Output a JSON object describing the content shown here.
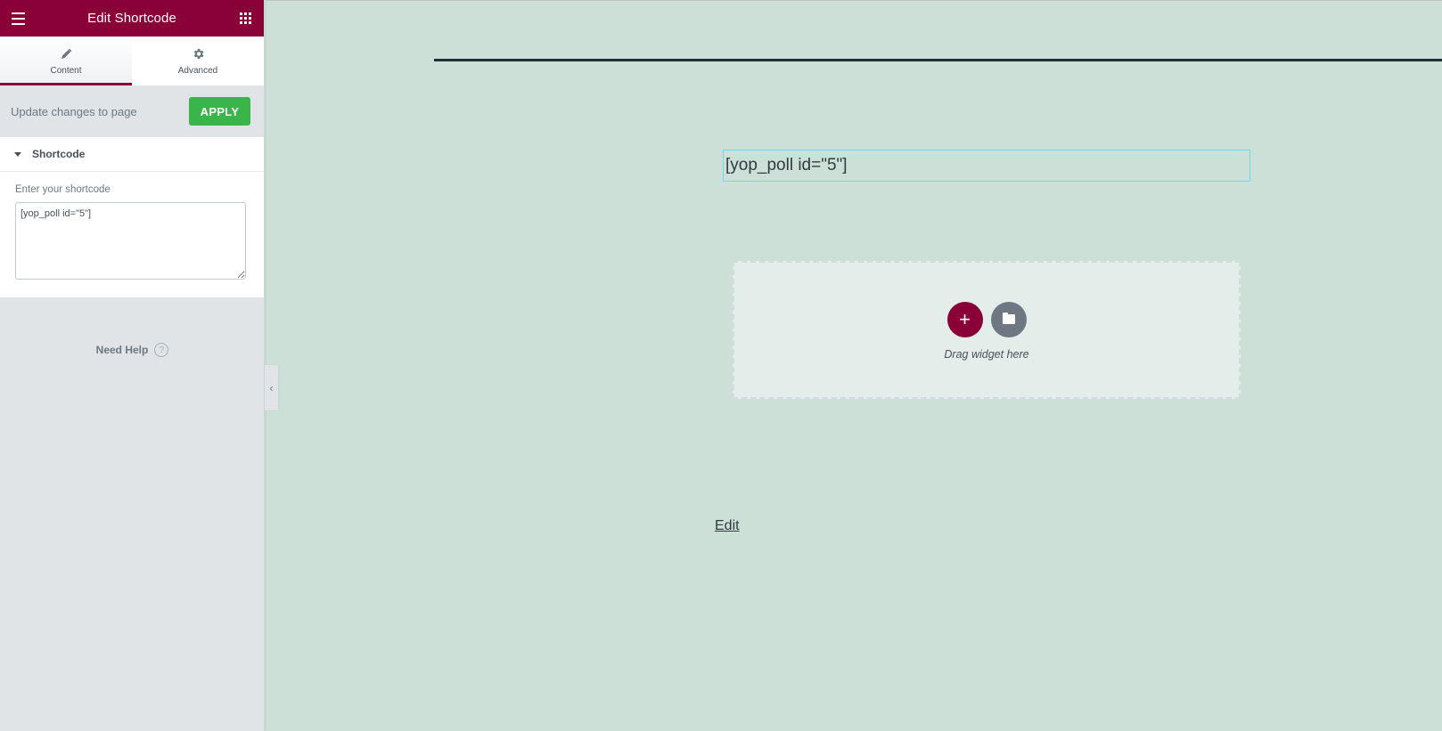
{
  "panel": {
    "header": {
      "title": "Edit Shortcode",
      "menu_icon": "hamburger-icon",
      "widgets_icon": "grid-icon"
    },
    "tabs": [
      {
        "label": "Content",
        "icon": "pencil-icon",
        "active": true
      },
      {
        "label": "Advanced",
        "icon": "gear-icon",
        "active": false
      }
    ],
    "apply": {
      "label": "Update changes to page",
      "button": "APPLY"
    },
    "section": {
      "title": "Shortcode",
      "control_label": "Enter your shortcode",
      "value": "[yop_poll id=\"5\"]"
    },
    "help": {
      "label": "Need Help",
      "icon": "?"
    },
    "collapse_icon": "‹"
  },
  "canvas": {
    "shortcode_text": "[yop_poll id=\"5\"]",
    "dropzone_text": "Drag widget here",
    "add_icon": "+",
    "edit_link": "Edit"
  },
  "colors": {
    "brand": "#8a0138",
    "apply": "#39b54a",
    "canvas_bg": "#cde0d7",
    "widget_outline": "#71d7f7"
  }
}
